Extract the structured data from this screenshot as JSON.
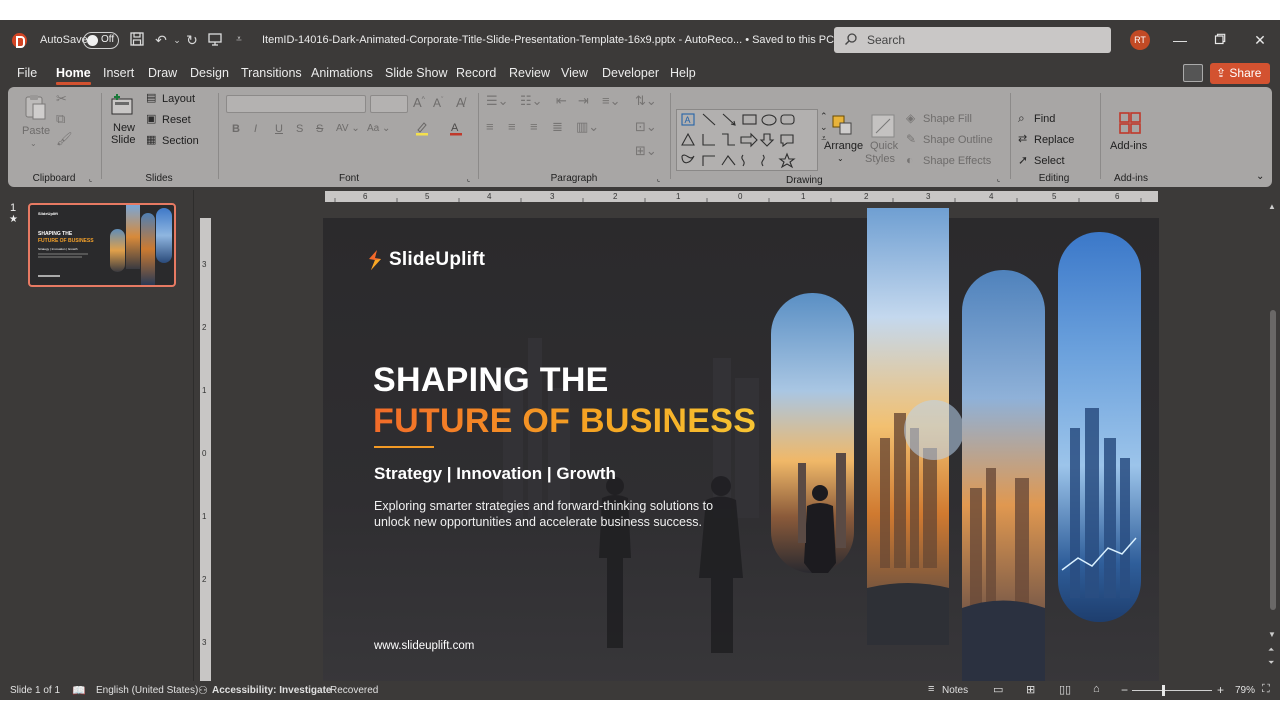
{
  "app": {
    "autosave_label": "AutoSave",
    "autosave_state": "Off",
    "doc_title": "ItemID-14016-Dark-Animated-Corporate-Title-Slide-Presentation-Template-16x9.pptx  -  AutoReco...  •  Saved to this PC",
    "search_placeholder": "Search",
    "user_initials": "RT",
    "accent": "#d35230"
  },
  "menu": {
    "tabs": [
      "File",
      "Home",
      "Insert",
      "Draw",
      "Design",
      "Transitions",
      "Animations",
      "Slide Show",
      "Record",
      "Review",
      "View",
      "Developer",
      "Help"
    ],
    "active_tab": "Home",
    "share_label": "Share"
  },
  "ribbon": {
    "clipboard": {
      "paste": "Paste",
      "group": "Clipboard"
    },
    "slides": {
      "new_slide": "New",
      "new_slide_2": "Slide",
      "layout": "Layout",
      "reset": "Reset",
      "section": "Section",
      "group": "Slides"
    },
    "font": {
      "group": "Font",
      "bold": "B",
      "italic": "I",
      "underline": "U",
      "strike": "S",
      "size_up": "A",
      "size_down": "A"
    },
    "paragraph": {
      "group": "Paragraph"
    },
    "drawing": {
      "arrange": "Arrange",
      "quick_styles_1": "Quick",
      "quick_styles_2": "Styles",
      "shape_fill": "Shape Fill",
      "shape_outline": "Shape Outline",
      "shape_effects": "Shape Effects",
      "group": "Drawing"
    },
    "editing": {
      "find": "Find",
      "replace": "Replace",
      "select": "Select",
      "group": "Editing"
    },
    "addins": {
      "label": "Add-ins",
      "group": "Add-ins"
    }
  },
  "thumbnails": {
    "slide_number": "1",
    "star": "★"
  },
  "ruler": {
    "h_labels": [
      "6",
      "5",
      "4",
      "3",
      "2",
      "1",
      "0",
      "1",
      "2",
      "3",
      "4",
      "5",
      "6"
    ],
    "v_labels": [
      "3",
      "2",
      "1",
      "0",
      "1",
      "2",
      "3"
    ]
  },
  "slide": {
    "logo_text": "SlideUplift",
    "title_line1": "SHAPING THE",
    "title_line2": "FUTURE OF BUSINESS",
    "subtitle": "Strategy | Innovation | Growth",
    "body": "Exploring smarter strategies and forward-thinking solutions to unlock new opportunities and accelerate business success.",
    "url": "www.slideuplift.com"
  },
  "thumb_slide": {
    "logo": "SlideUplift",
    "t1": "SHAPING THE",
    "t2": "FUTURE OF BUSINESS",
    "sub": "Strategy | Innovation | Growth"
  },
  "status": {
    "slide_count": "Slide 1 of 1",
    "language": "English (United States)",
    "accessibility": "Accessibility: Investigate",
    "recovered": "Recovered",
    "notes": "Notes",
    "zoom": "79%"
  }
}
